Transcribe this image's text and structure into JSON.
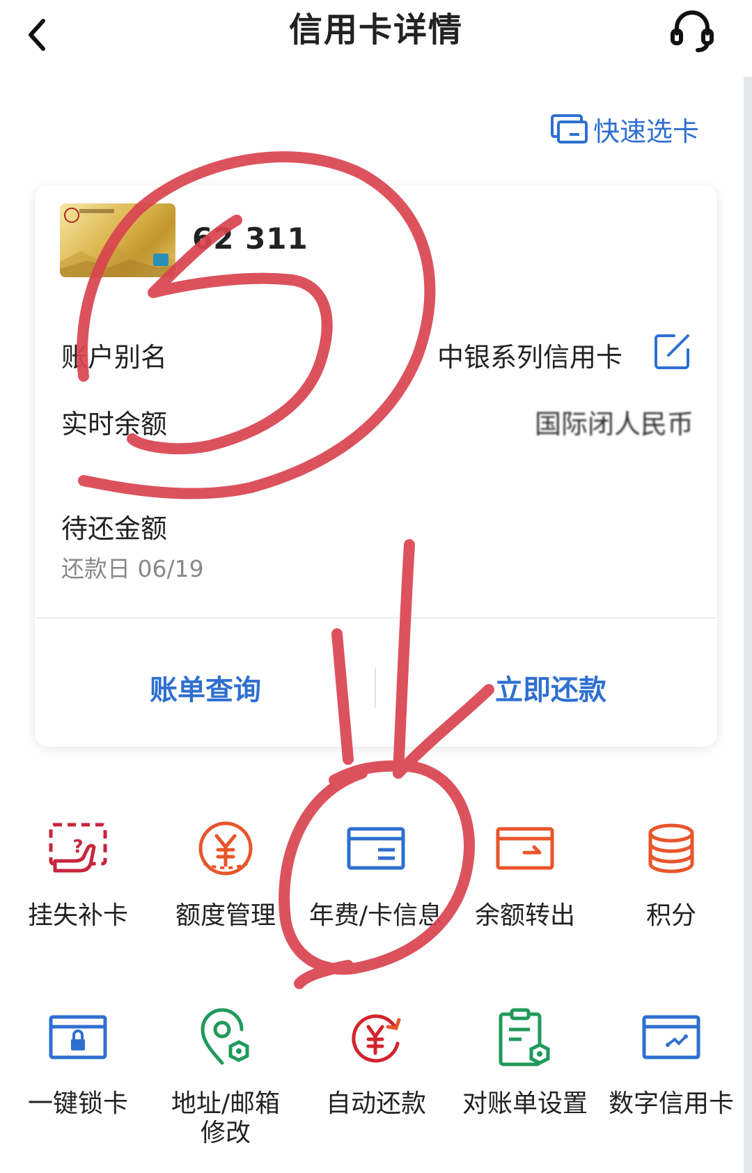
{
  "header": {
    "title": "信用卡详情"
  },
  "quick_select": {
    "label": "快速选卡"
  },
  "card": {
    "number": "62 311",
    "rows": {
      "alias_label": "账户别名",
      "alias_value": "中银系列信用卡",
      "balance_label": "实时余额",
      "balance_value": "国际闭人民币",
      "due_label": "待还金额",
      "due_date": "还款日 06/19"
    },
    "actions": {
      "bill_query": "账单查询",
      "pay_now": "立即还款"
    }
  },
  "grid": {
    "row1": [
      {
        "label": "挂失补卡",
        "icon": "lost-card-icon"
      },
      {
        "label": "额度管理",
        "icon": "credit-limit-icon"
      },
      {
        "label": "年费/卡信息",
        "icon": "card-info-icon"
      },
      {
        "label": "余额转出",
        "icon": "balance-transfer-icon"
      },
      {
        "label": "积分",
        "icon": "points-icon"
      }
    ],
    "row2": [
      {
        "label": "一键锁卡",
        "icon": "lock-card-icon"
      },
      {
        "label": "地址/邮箱\n修改",
        "icon": "address-edit-icon"
      },
      {
        "label": "自动还款",
        "icon": "auto-repay-icon"
      },
      {
        "label": "对账单设置",
        "icon": "statement-settings-icon"
      },
      {
        "label": "数字信用卡",
        "icon": "digital-card-icon"
      }
    ]
  },
  "colors": {
    "accent_blue": "#2f6fd0",
    "red": "#d0242c",
    "orange": "#e8552a",
    "green": "#1f9a5a",
    "annotation_red": "#d94450"
  }
}
